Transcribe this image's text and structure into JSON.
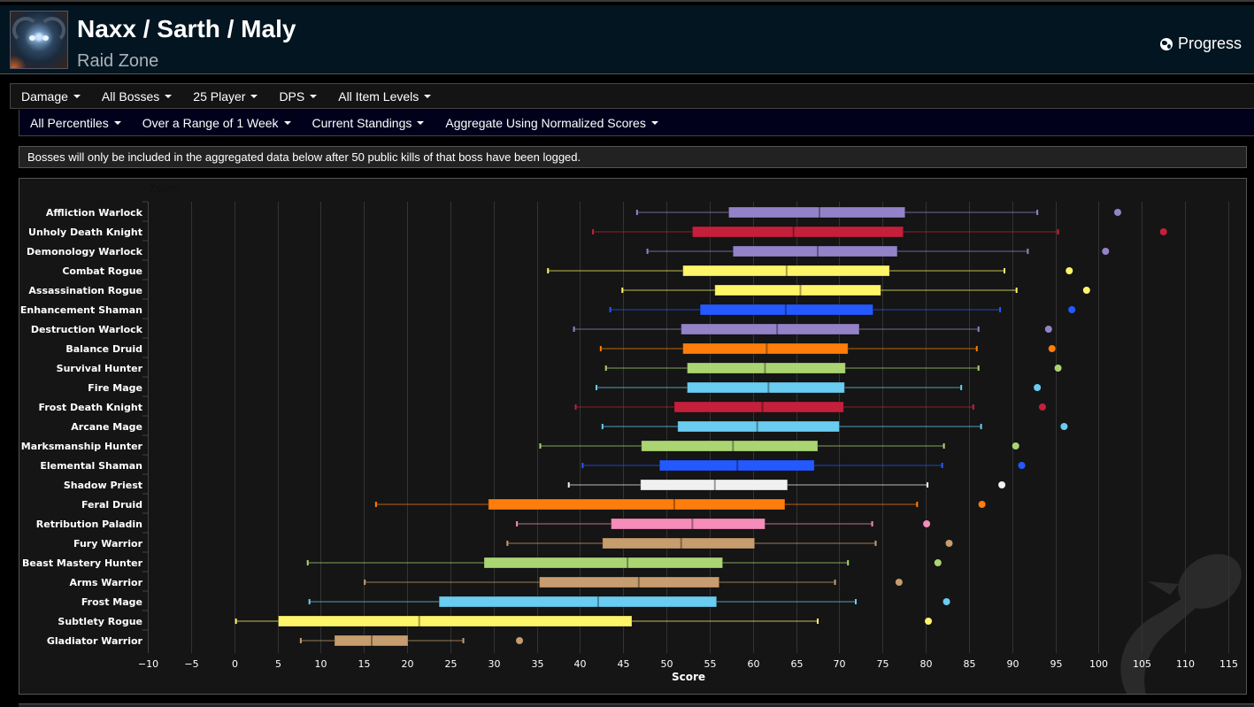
{
  "header": {
    "title": "Naxx / Sarth / Maly",
    "subtitle": "Raid Zone",
    "progress_label": "Progress",
    "zone_icon": "raid-boss-portrait-icon"
  },
  "filters_row1": [
    {
      "label": "Damage"
    },
    {
      "label": "All Bosses"
    },
    {
      "label": "25 Player"
    },
    {
      "label": "DPS"
    },
    {
      "label": "All Item Levels"
    }
  ],
  "filters_row2": [
    {
      "label": "All Percentiles"
    },
    {
      "label": "Over a Range of 1 Week"
    },
    {
      "label": "Current Standings"
    },
    {
      "label": "Aggregate Using Normalized Scores"
    }
  ],
  "notice": "Bosses will only be included in the aggregated data below after 50 public kills of that boss have been logged.",
  "chart_data": {
    "type": "boxplot",
    "orientation": "horizontal",
    "zoom_label": "Zoom",
    "title": "",
    "xlabel": "Score",
    "ylabel": "",
    "xlim": [
      -10,
      115
    ],
    "xticks": [
      -10,
      -5,
      0,
      5,
      10,
      15,
      20,
      25,
      30,
      35,
      40,
      45,
      50,
      55,
      60,
      65,
      70,
      75,
      80,
      85,
      90,
      95,
      100,
      105,
      110,
      115
    ],
    "grid": "vertical",
    "legend": "none",
    "series": [
      {
        "name": "Affliction Warlock",
        "color": "#9482c9",
        "low": 46.6,
        "q1": 57.2,
        "median": 67.7,
        "q3": 77.6,
        "high": 92.9,
        "outlier": 102.2
      },
      {
        "name": "Unholy Death Knight",
        "color": "#c41f3b",
        "low": 41.5,
        "q1": 53.0,
        "median": 64.7,
        "q3": 77.4,
        "high": 95.3,
        "outlier": 107.5
      },
      {
        "name": "Demonology Warlock",
        "color": "#9482c9",
        "low": 47.8,
        "q1": 57.7,
        "median": 67.5,
        "q3": 76.7,
        "high": 91.8,
        "outlier": 100.8
      },
      {
        "name": "Combat Rogue",
        "color": "#fff569",
        "low": 36.3,
        "q1": 51.9,
        "median": 63.9,
        "q3": 75.8,
        "high": 89.1,
        "outlier": 96.6
      },
      {
        "name": "Assassination Rogue",
        "color": "#fff569",
        "low": 44.9,
        "q1": 55.6,
        "median": 65.5,
        "q3": 74.8,
        "high": 90.5,
        "outlier": 98.6
      },
      {
        "name": "Enhancement Shaman",
        "color": "#2459ff",
        "low": 43.5,
        "q1": 53.9,
        "median": 63.8,
        "q3": 73.9,
        "high": 88.6,
        "outlier": 96.9
      },
      {
        "name": "Destruction Warlock",
        "color": "#9482c9",
        "low": 39.3,
        "q1": 51.7,
        "median": 62.8,
        "q3": 72.3,
        "high": 86.1,
        "outlier": 94.2
      },
      {
        "name": "Balance Druid",
        "color": "#ff7d0a",
        "low": 42.4,
        "q1": 51.9,
        "median": 61.6,
        "q3": 71.0,
        "high": 85.9,
        "outlier": 94.6
      },
      {
        "name": "Survival Hunter",
        "color": "#abd473",
        "low": 43.0,
        "q1": 52.4,
        "median": 61.4,
        "q3": 70.7,
        "high": 86.1,
        "outlier": 95.3
      },
      {
        "name": "Fire Mage",
        "color": "#69ccf0",
        "low": 41.9,
        "q1": 52.4,
        "median": 61.8,
        "q3": 70.6,
        "high": 84.1,
        "outlier": 92.9
      },
      {
        "name": "Frost Death Knight",
        "color": "#c41f3b",
        "low": 39.5,
        "q1": 50.9,
        "median": 61.1,
        "q3": 70.5,
        "high": 85.5,
        "outlier": 93.5
      },
      {
        "name": "Arcane Mage",
        "color": "#69ccf0",
        "low": 42.6,
        "q1": 51.3,
        "median": 60.5,
        "q3": 70.0,
        "high": 86.4,
        "outlier": 96.0
      },
      {
        "name": "Marksmanship Hunter",
        "color": "#abd473",
        "low": 35.4,
        "q1": 47.1,
        "median": 57.7,
        "q3": 67.5,
        "high": 82.1,
        "outlier": 90.4
      },
      {
        "name": "Elemental Shaman",
        "color": "#2459ff",
        "low": 40.3,
        "q1": 49.2,
        "median": 58.2,
        "q3": 67.1,
        "high": 81.9,
        "outlier": 91.1
      },
      {
        "name": "Shadow Priest",
        "color": "#f0f0f0",
        "low": 38.7,
        "q1": 47.0,
        "median": 55.6,
        "q3": 64.0,
        "high": 80.2,
        "outlier": 88.8
      },
      {
        "name": "Feral Druid",
        "color": "#ff7d0a",
        "low": 16.4,
        "q1": 29.4,
        "median": 50.9,
        "q3": 63.7,
        "high": 79.0,
        "outlier": 86.5
      },
      {
        "name": "Retribution Paladin",
        "color": "#f58cba",
        "low": 32.7,
        "q1": 43.6,
        "median": 53.0,
        "q3": 61.4,
        "high": 73.8,
        "outlier": 80.1
      },
      {
        "name": "Fury Warrior",
        "color": "#c79c6e",
        "low": 31.6,
        "q1": 42.6,
        "median": 51.7,
        "q3": 60.2,
        "high": 74.2,
        "outlier": 82.7
      },
      {
        "name": "Beast Mastery Hunter",
        "color": "#abd473",
        "low": 8.5,
        "q1": 28.9,
        "median": 45.5,
        "q3": 56.5,
        "high": 71.0,
        "outlier": 81.4
      },
      {
        "name": "Arms Warrior",
        "color": "#c79c6e",
        "low": 15.1,
        "q1": 35.3,
        "median": 46.8,
        "q3": 56.1,
        "high": 69.5,
        "outlier": 76.9
      },
      {
        "name": "Frost Mage",
        "color": "#69ccf0",
        "low": 8.7,
        "q1": 23.7,
        "median": 42.1,
        "q3": 55.8,
        "high": 71.9,
        "outlier": 82.4
      },
      {
        "name": "Subtlety Rogue",
        "color": "#fff569",
        "low": 0.2,
        "q1": 5.1,
        "median": 21.4,
        "q3": 46.0,
        "high": 67.5,
        "outlier": 80.3
      },
      {
        "name": "Gladiator Warrior",
        "color": "#c79c6e",
        "low": 7.7,
        "q1": 11.6,
        "median": 15.9,
        "q3": 20.1,
        "high": 26.5,
        "outlier": 33.0
      }
    ]
  }
}
